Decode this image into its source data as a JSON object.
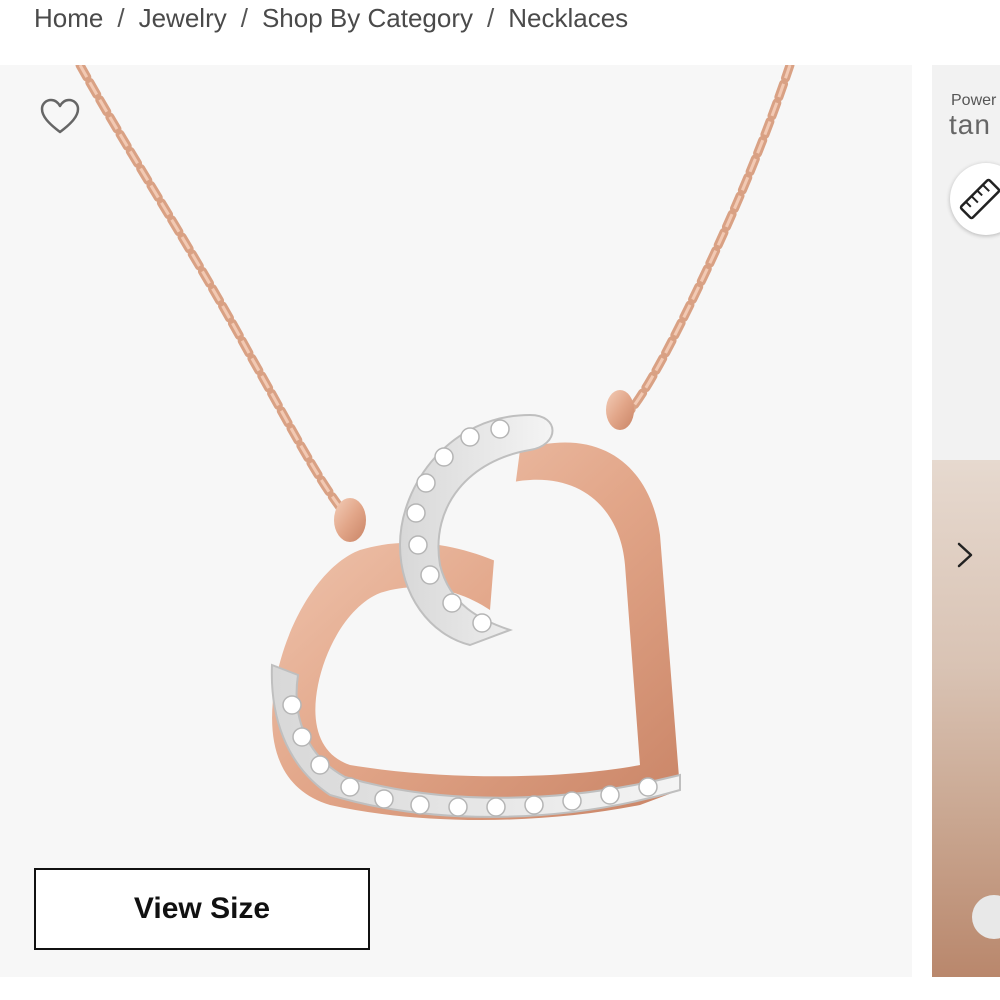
{
  "breadcrumb": {
    "items": [
      {
        "label": "Home"
      },
      {
        "label": "Jewelry"
      },
      {
        "label": "Shop By Category"
      },
      {
        "label": "Necklaces"
      }
    ],
    "separator": "/"
  },
  "product_image": {
    "wishlist_icon": "heart-outline-icon",
    "view_size_label": "View Size",
    "metal_color": "#e8b49a",
    "background_color": "#f7f7f7"
  },
  "side_panel": {
    "powered_text": "Power",
    "brand_text": "tan",
    "ruler_icon": "ruler-icon",
    "next_icon": "chevron-right-icon"
  }
}
